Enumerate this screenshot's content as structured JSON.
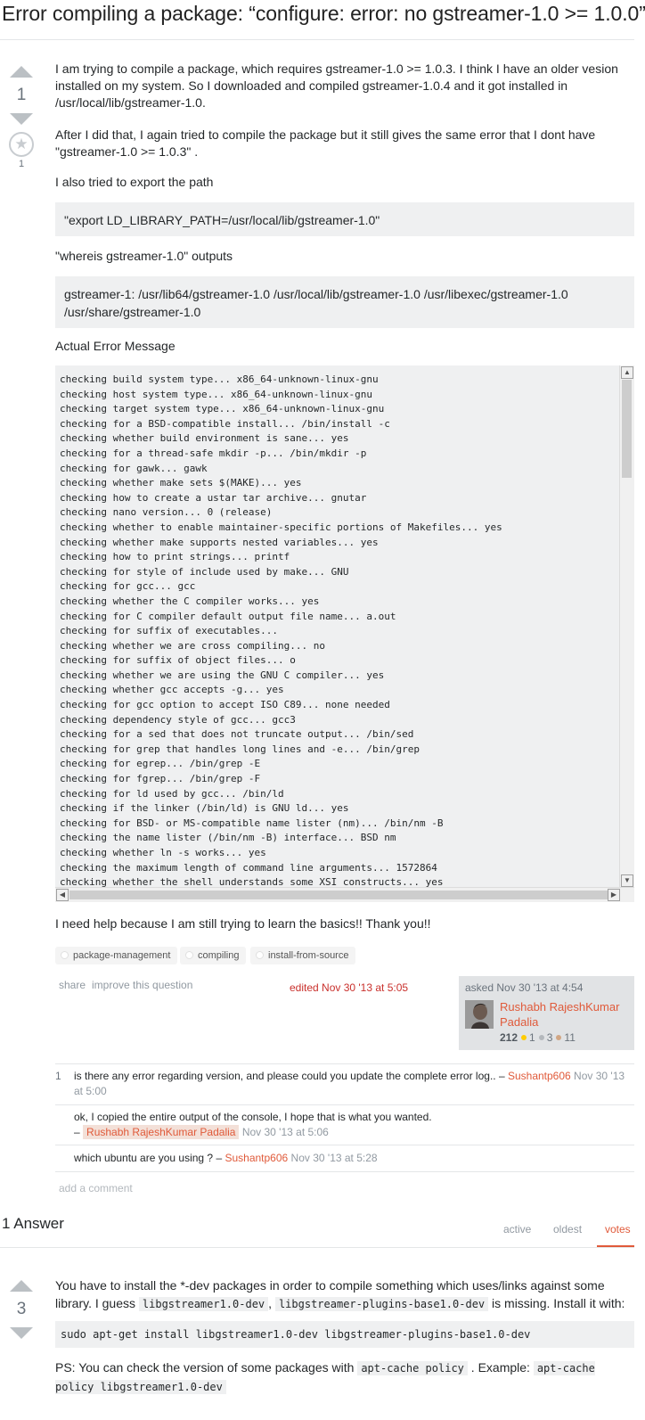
{
  "question": {
    "title": "Error compiling a package: “configure: error: no gstreamer-1.0 >= 1.0.0”",
    "votes": "1",
    "favorites": "1",
    "favorite_icon": "star-icon",
    "p1": "I am trying to compile a package, which requires gstreamer-1.0 >= 1.0.3. I think I have an older vesion installed on my system. So I downloaded and compiled gstreamer-1.0.4 and it got installed in /usr/local/lib/gstreamer-1.0.",
    "p2": "After I did that, I again tried to compile the package but it still gives the same error that I dont have \"gstreamer-1.0 >= 1.0.3\" .",
    "p3": "I also tried to export the path",
    "export_block": "\"export LD_LIBRARY_PATH=/usr/local/lib/gstreamer-1.0\"",
    "p4": "\"whereis gstreamer-1.0\" outputs",
    "whereis_block": "gstreamer-1: /usr/lib64/gstreamer-1.0 /usr/local/lib/gstreamer-1.0 /usr/libexec/gstreamer-1.0 /usr/share/gstreamer-1.0",
    "p5": "Actual Error Message",
    "error_log": [
      "checking build system type... x86_64-unknown-linux-gnu",
      "checking host system type... x86_64-unknown-linux-gnu",
      "checking target system type... x86_64-unknown-linux-gnu",
      "checking for a BSD-compatible install... /bin/install -c",
      "checking whether build environment is sane... yes",
      "checking for a thread-safe mkdir -p... /bin/mkdir -p",
      "checking for gawk... gawk",
      "checking whether make sets $(MAKE)... yes",
      "checking how to create a ustar tar archive... gnutar",
      "checking nano version... 0 (release)",
      "checking whether to enable maintainer-specific portions of Makefiles... yes",
      "checking whether make supports nested variables... yes",
      "checking how to print strings... printf",
      "checking for style of include used by make... GNU",
      "checking for gcc... gcc",
      "checking whether the C compiler works... yes",
      "checking for C compiler default output file name... a.out",
      "checking for suffix of executables...",
      "checking whether we are cross compiling... no",
      "checking for suffix of object files... o",
      "checking whether we are using the GNU C compiler... yes",
      "checking whether gcc accepts -g... yes",
      "checking for gcc option to accept ISO C89... none needed",
      "checking dependency style of gcc... gcc3",
      "checking for a sed that does not truncate output... /bin/sed",
      "checking for grep that handles long lines and -e... /bin/grep",
      "checking for egrep... /bin/grep -E",
      "checking for fgrep... /bin/grep -F",
      "checking for ld used by gcc... /bin/ld",
      "checking if the linker (/bin/ld) is GNU ld... yes",
      "checking for BSD- or MS-compatible name lister (nm)... /bin/nm -B",
      "checking the name lister (/bin/nm -B) interface... BSD nm",
      "checking whether ln -s works... yes",
      "checking the maximum length of command line arguments... 1572864",
      "checking whether the shell understands some XSI constructs... yes"
    ],
    "p6": "I need help because I am still trying to learn the basics!! Thank you!!",
    "tags": [
      "package-management",
      "compiling",
      "install-from-source"
    ],
    "share": "share",
    "improve": "improve this question",
    "edited": "edited Nov 30 '13 at 5:05",
    "asked": "asked Nov 30 '13 at 4:54",
    "user_name": "Rushabh RajeshKumar Padalia",
    "user_rep": "212",
    "badge_gold": "1",
    "badge_silver": "3",
    "badge_bronze": "11",
    "badge_colors": {
      "gold": "#ffcc01",
      "silver": "#b4b8bc",
      "bronze": "#d1a684"
    }
  },
  "comments": [
    {
      "score": "1",
      "text": "is there any error regarding version, and please could you update the complete error log.. –",
      "user": "Sushantp606",
      "date": "Nov 30 '13 at 5:00"
    },
    {
      "score": "",
      "text": "ok, I copied the entire output of the console, I hope that is what you wanted.",
      "dash": "–",
      "user": "Rushabh RajeshKumar Padalia",
      "date": "Nov 30 '13 at 5:06"
    },
    {
      "score": "",
      "text": "which ubuntu are you using ? –",
      "user": "Sushantp606",
      "date": "Nov 30 '13 at 5:28"
    }
  ],
  "add_comment": "add a comment",
  "answers": {
    "heading": "1 Answer",
    "tabs": [
      "active",
      "oldest",
      "votes"
    ],
    "accent": "#e05a3a"
  },
  "answer": {
    "votes": "3",
    "p1a": "You have to install the *-dev packages in order to compile something which uses/links against some library. I guess",
    "code1": "libgstreamer1.0-dev",
    "p1b": ",",
    "code2": "libgstreamer-plugins-base1.0-dev",
    "p1c": "is missing. Install it with:",
    "command": "sudo apt-get install libgstreamer1.0-dev libgstreamer-plugins-base1.0-dev",
    "p2a": "PS: You can check the version of some packages with",
    "code3": "apt-cache policy",
    "p2b": ". Example:",
    "code4": "apt-cache policy libgstreamer1.0-dev"
  }
}
